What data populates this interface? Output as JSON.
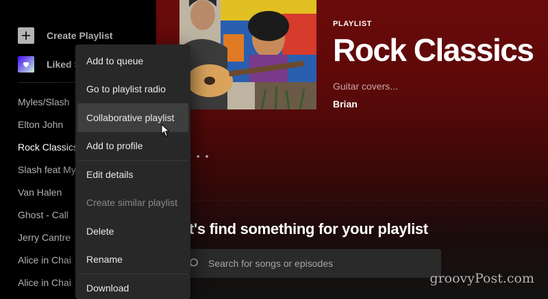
{
  "sidebar": {
    "create_playlist_label": "Create Playlist",
    "liked_songs_label": "Liked S",
    "playlists": [
      "Myles/Slash",
      "Elton John",
      "Rock Classics",
      "Slash feat My",
      "Van Halen",
      "Ghost - Call",
      "Jerry Cantre",
      "Alice in Chai",
      "Alice in Chai"
    ],
    "active_playlist": "Rock Classics"
  },
  "playlist": {
    "type_label": "PLAYLIST",
    "title": "Rock Classics",
    "description": "Guitar covers...",
    "owner": "Brian"
  },
  "find_section": {
    "heading": "et's find something for your playlist",
    "search_placeholder": "Search for songs or episodes"
  },
  "context_menu": {
    "items": [
      "Add to queue",
      "Go to playlist radio",
      "Collaborative playlist",
      "Add to profile",
      "Edit details",
      "Create similar playlist",
      "Delete",
      "Rename",
      "Download"
    ],
    "hovered_item": "Collaborative playlist",
    "disabled_item": "Create similar playlist"
  },
  "watermark": "groovyPost.com",
  "colors": {
    "header_red": "#6a0a0a",
    "menu_bg": "#282828",
    "menu_hover": "#3e3e3e",
    "sidebar_bg": "#000000"
  }
}
